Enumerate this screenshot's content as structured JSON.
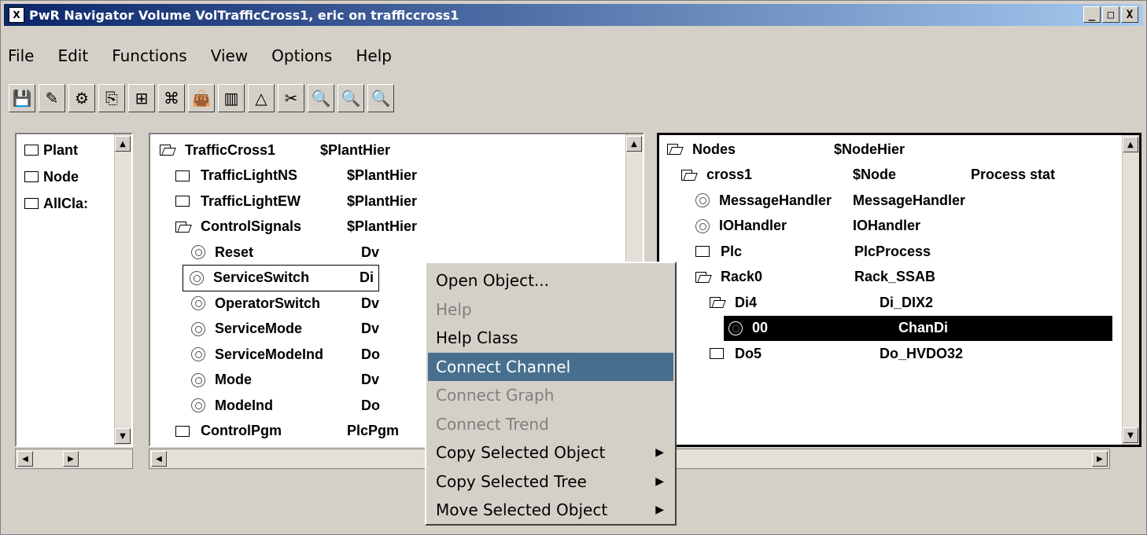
{
  "window": {
    "title": "PwR Navigator Volume VolTrafficCross1, eric on trafficcross1",
    "icon_glyph": "X",
    "controls": {
      "minimize": "_",
      "maximize": "□",
      "close": "X"
    }
  },
  "menubar": [
    "File",
    "Edit",
    "Functions",
    "View",
    "Options",
    "Help"
  ],
  "toolbar": [
    {
      "name": "save-icon",
      "glyph": "💾"
    },
    {
      "name": "edit-icon",
      "glyph": "✎"
    },
    {
      "name": "gear-icon",
      "glyph": "⚙"
    },
    {
      "name": "navigator-icon",
      "glyph": "⎘"
    },
    {
      "name": "hierarchy-icon",
      "glyph": "⊞"
    },
    {
      "name": "plc-icon",
      "glyph": "⌘"
    },
    {
      "name": "bag-icon",
      "glyph": "👜"
    },
    {
      "name": "split-icon",
      "glyph": "▥"
    },
    {
      "name": "warning-icon",
      "glyph": "△"
    },
    {
      "name": "tools-icon",
      "glyph": "✂"
    },
    {
      "name": "zoom-in-icon",
      "glyph": "🔍"
    },
    {
      "name": "zoom-icon",
      "glyph": "🔍"
    },
    {
      "name": "zoom-reset-icon",
      "glyph": "🔍"
    }
  ],
  "left_pane": {
    "items": [
      "Plant",
      "Node",
      "AllCla:"
    ]
  },
  "middle_pane": {
    "rows": [
      {
        "icon": "folder-open",
        "name": "TrafficCross1",
        "cls": "$PlantHier",
        "indent": 0
      },
      {
        "icon": "folder",
        "name": "TrafficLightNS",
        "cls": "$PlantHier",
        "indent": 1
      },
      {
        "icon": "folder",
        "name": "TrafficLightEW",
        "cls": "$PlantHier",
        "indent": 1
      },
      {
        "icon": "folder-open",
        "name": "ControlSignals",
        "cls": "$PlantHier",
        "indent": 1
      },
      {
        "icon": "object",
        "name": "Reset",
        "cls": "Dv",
        "indent": 2
      },
      {
        "icon": "object",
        "name": "ServiceSwitch",
        "cls": "Di",
        "indent": 2,
        "selected": true
      },
      {
        "icon": "object",
        "name": "OperatorSwitch",
        "cls": "Dv",
        "indent": 2
      },
      {
        "icon": "object",
        "name": "ServiceMode",
        "cls": "Dv",
        "indent": 2
      },
      {
        "icon": "object",
        "name": "ServiceModeInd",
        "cls": "Do",
        "indent": 2
      },
      {
        "icon": "object",
        "name": "Mode",
        "cls": "Dv",
        "indent": 2
      },
      {
        "icon": "object",
        "name": "ModeInd",
        "cls": "Do",
        "indent": 2
      },
      {
        "icon": "folder",
        "name": "ControlPgm",
        "cls": "PlcPgm",
        "indent": 1
      }
    ]
  },
  "right_pane": {
    "rows": [
      {
        "icon": "folder-open",
        "name": "Nodes",
        "cls": "$NodeHier",
        "extra": "",
        "indent": 0
      },
      {
        "icon": "folder-open",
        "name": "cross1",
        "cls": "$Node",
        "extra": "Process stat",
        "indent": 1
      },
      {
        "icon": "object",
        "name": "MessageHandler",
        "cls": "MessageHandler",
        "extra": "",
        "indent": 2
      },
      {
        "icon": "object",
        "name": "IOHandler",
        "cls": "IOHandler",
        "extra": "",
        "indent": 2
      },
      {
        "icon": "folder",
        "name": "Plc",
        "cls": "PlcProcess",
        "extra": "",
        "indent": 2
      },
      {
        "icon": "folder-open",
        "name": "Rack0",
        "cls": "Rack_SSAB",
        "extra": "",
        "indent": 2
      },
      {
        "icon": "folder-open",
        "name": "Di4",
        "cls": "Di_DIX2",
        "extra": "",
        "indent": 3
      },
      {
        "icon": "object",
        "name": "00",
        "cls": "ChanDi",
        "extra": "",
        "indent": 4,
        "highlighted": true
      },
      {
        "icon": "folder",
        "name": "Do5",
        "cls": "Do_HVDO32",
        "extra": "",
        "indent": 3
      }
    ]
  },
  "context_menu": {
    "items": [
      {
        "label": "Open Object...",
        "state": "enabled",
        "submenu": false
      },
      {
        "label": "Help",
        "state": "disabled",
        "submenu": false
      },
      {
        "label": "Help Class",
        "state": "enabled",
        "submenu": false
      },
      {
        "label": "Connect Channel",
        "state": "selected",
        "submenu": false
      },
      {
        "label": "Connect Graph",
        "state": "disabled",
        "submenu": false
      },
      {
        "label": "Connect Trend",
        "state": "disabled",
        "submenu": false
      },
      {
        "label": "Copy Selected Object",
        "state": "enabled",
        "submenu": true
      },
      {
        "label": "Copy Selected Tree",
        "state": "enabled",
        "submenu": true
      },
      {
        "label": "Move Selected Object",
        "state": "enabled",
        "submenu": true
      }
    ],
    "submenu_glyph": "▶"
  },
  "scroll_glyphs": {
    "up": "▲",
    "down": "▼",
    "left": "◀",
    "right": "▶"
  },
  "colors": {
    "menu_selected": "#48708e",
    "title_start": "#0a246a",
    "title_end": "#a6caf0"
  }
}
